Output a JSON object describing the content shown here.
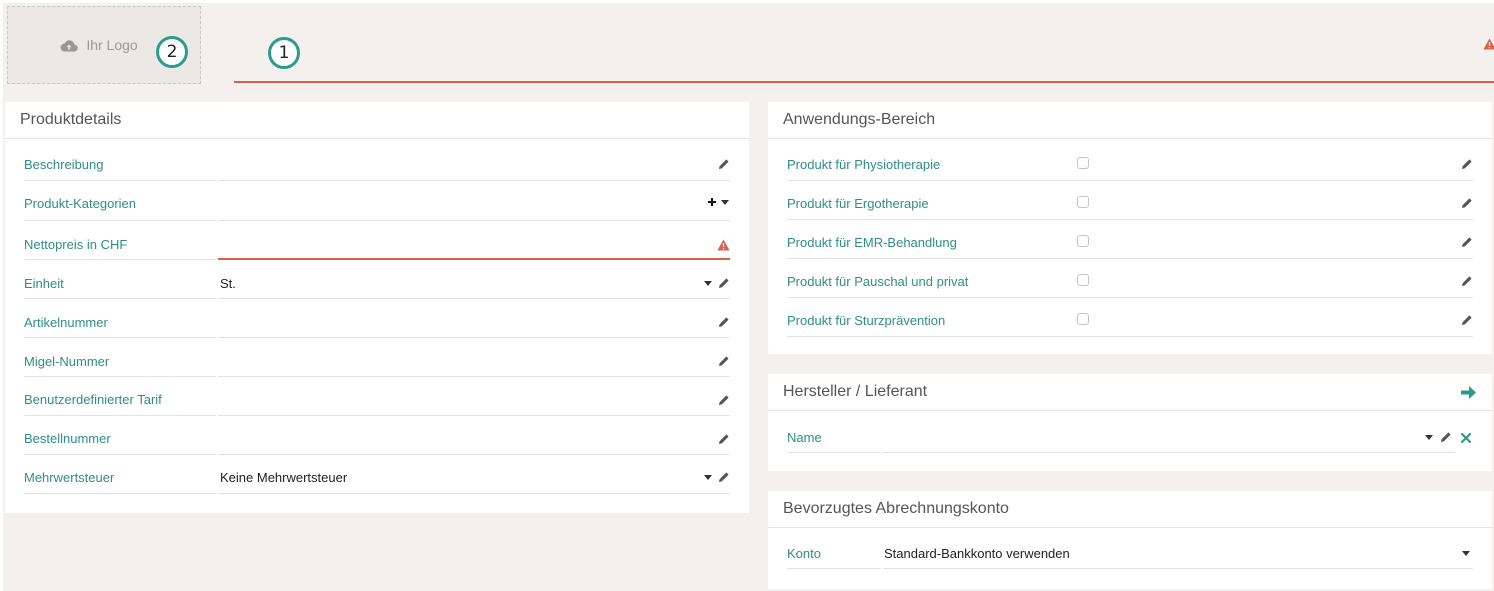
{
  "header": {
    "logo_label": "Ihr Logo",
    "callout_logo": "2",
    "callout_title": "1"
  },
  "produktdetails": {
    "title": "Produktdetails",
    "fields": [
      {
        "label": "Beschreibung",
        "value": "",
        "icons": [
          "pencil-icon"
        ]
      },
      {
        "label": "Produkt-Kategorien",
        "value": "",
        "icons": [
          "plus-icon",
          "caret-down-icon"
        ]
      },
      {
        "label": "Nettopreis in CHF",
        "value": "",
        "icons": [
          "warning-icon"
        ]
      },
      {
        "label": "Einheit",
        "value": "St.",
        "icons": [
          "caret-down-icon",
          "pencil-icon"
        ]
      },
      {
        "label": "Artikelnummer",
        "value": "",
        "icons": [
          "pencil-icon"
        ]
      },
      {
        "label": "Migel-Nummer",
        "value": "",
        "icons": [
          "pencil-icon"
        ]
      },
      {
        "label": "Benutzerdefinierter Tarif",
        "value": "",
        "icons": [
          "pencil-icon"
        ]
      },
      {
        "label": "Bestellnummer",
        "value": "",
        "icons": [
          "pencil-icon"
        ]
      },
      {
        "label": "Mehrwertsteuer",
        "value": "Keine Mehrwertsteuer",
        "icons": [
          "caret-down-icon",
          "pencil-icon"
        ]
      }
    ]
  },
  "anwendung": {
    "title": "Anwendungs-Bereich",
    "items": [
      {
        "label": "Produkt für Physiotherapie",
        "checked": false
      },
      {
        "label": "Produkt für Ergotherapie",
        "checked": false
      },
      {
        "label": "Produkt für EMR-Behandlung",
        "checked": false
      },
      {
        "label": "Produkt für Pauschal und privat",
        "checked": false
      },
      {
        "label": "Produkt für Sturzprävention",
        "checked": false
      }
    ]
  },
  "hersteller": {
    "title": "Hersteller / Lieferant",
    "name_label": "Name",
    "name_value": ""
  },
  "abrechnung": {
    "title": "Bevorzugtes Abrechnungskonto",
    "konto_label": "Konto",
    "konto_value": "Standard-Bankkonto verwenden"
  },
  "colors": {
    "accent": "#2f8f86",
    "error": "#d9614a",
    "background": "#f3f0ee"
  }
}
